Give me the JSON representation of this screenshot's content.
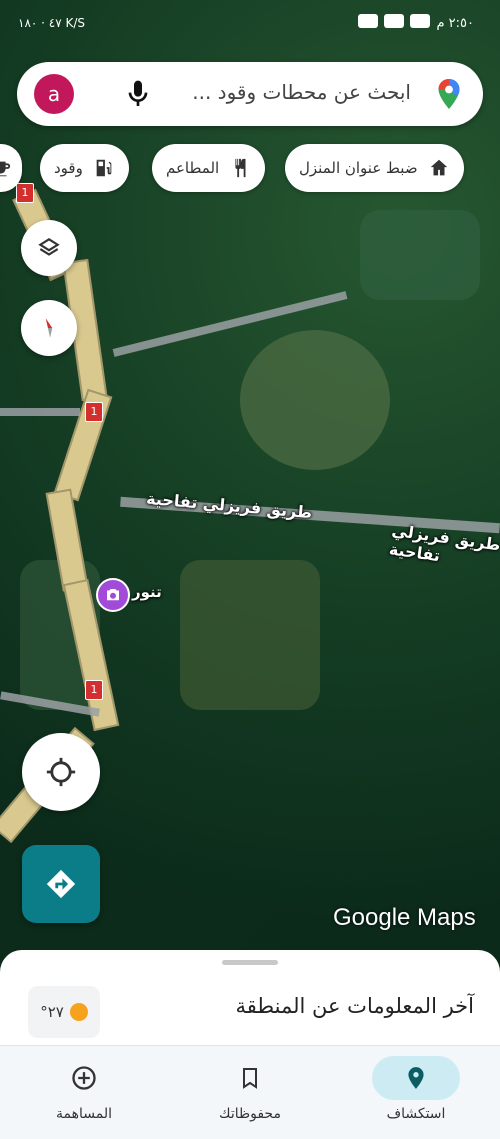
{
  "status_bar": {
    "time": "٢:٥٠ م",
    "left_info": "٤٧ · ١٨٠ K/S"
  },
  "search": {
    "avatar_letter": "a",
    "placeholder_text": "ابحث عن محطات وقود ..."
  },
  "chips": [
    {
      "label": "ضبط عنوان المنزل",
      "icon": "home-icon"
    },
    {
      "label": "المطاعم",
      "icon": "restaurant-icon"
    },
    {
      "label": "وقود",
      "icon": "gas-station-icon"
    }
  ],
  "map": {
    "road_label_1": "طريق فريزلي تفاحية",
    "road_label_2": "طريق فريزلي تفاحية",
    "road_sign": "1",
    "place_label": "تنور",
    "watermark": "Google Maps"
  },
  "bottom_sheet": {
    "title": "آخر المعلومات عن المنطقة",
    "temperature": "°٢٧"
  },
  "bottom_nav": [
    {
      "label": "استكشاف",
      "icon": "location-pin-icon",
      "active": true
    },
    {
      "label": "محفوظاتك",
      "icon": "bookmark-icon",
      "active": false
    },
    {
      "label": "المساهمة",
      "icon": "add-circle-icon",
      "active": false
    }
  ],
  "colors": {
    "accent_teal": "#0b7d88",
    "avatar": "#c2185b",
    "active_nav_pill": "#cdebf3",
    "photo_pin": "#a24bd8"
  }
}
